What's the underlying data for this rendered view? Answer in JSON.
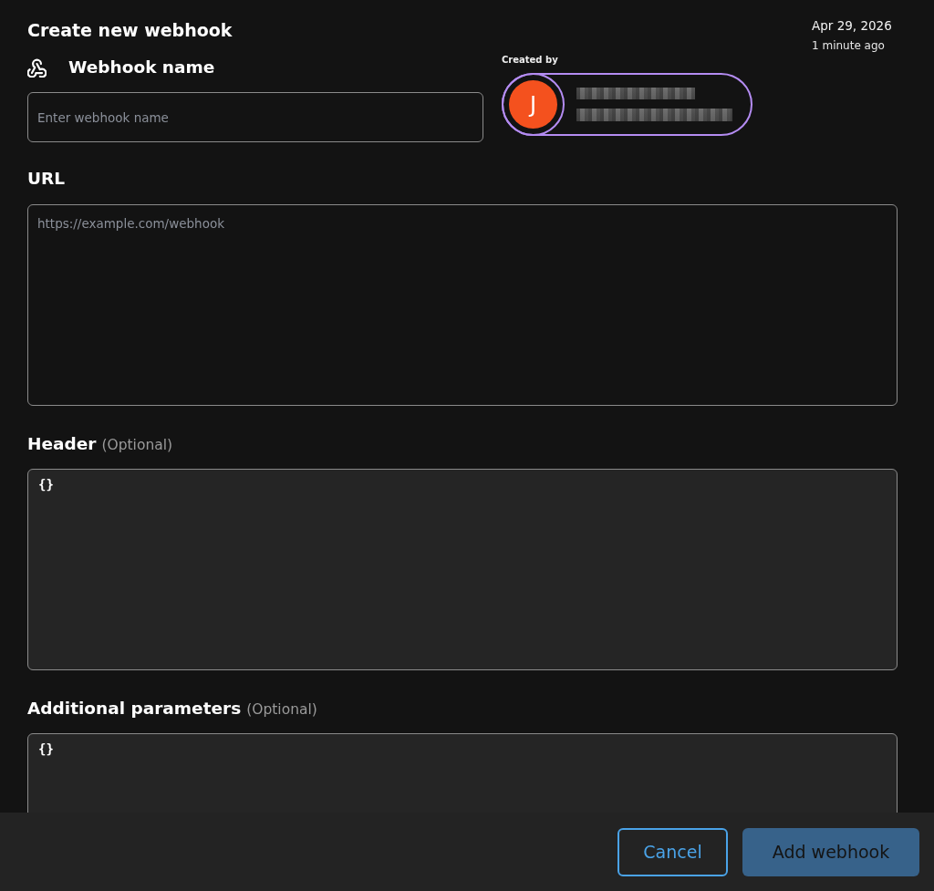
{
  "header": {
    "title": "Create new webhook",
    "date": "Apr 29, 2026",
    "relative_time": "1 minute ago"
  },
  "name_field": {
    "label": "Webhook name",
    "placeholder": "Enter webhook name"
  },
  "created_by": {
    "label": "Created by",
    "avatar_initial": "J"
  },
  "fields": [
    {
      "kind": "url",
      "label": "URL",
      "placeholder": "https://example.com/webhook"
    },
    {
      "kind": "json",
      "label": "Header",
      "hint": "(Optional)",
      "value": "{}"
    },
    {
      "kind": "json",
      "label": "Additional parameters",
      "hint": "(Optional)",
      "value": "{}"
    }
  ],
  "buttons": [
    {
      "label": "Cancel",
      "kind": "secondary"
    },
    {
      "label": "Add webhook",
      "kind": "primary"
    }
  ]
}
